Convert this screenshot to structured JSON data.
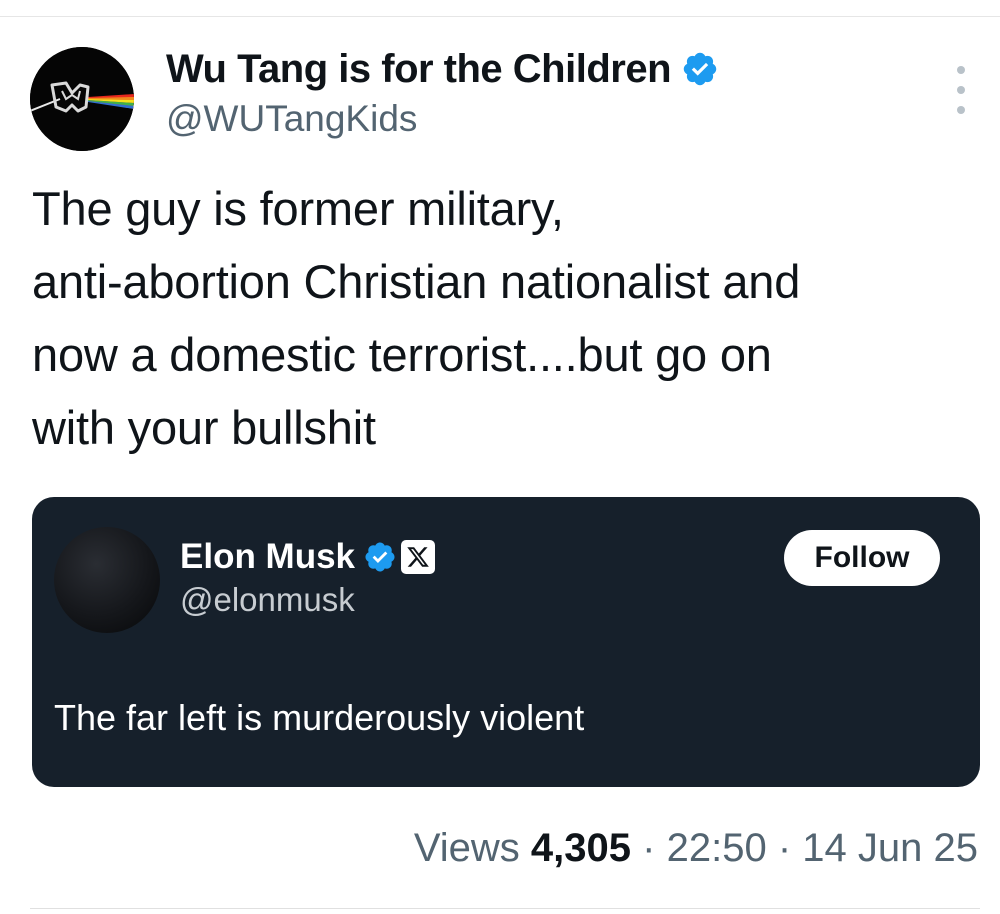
{
  "tweet": {
    "author": {
      "display_name": "Wu Tang is for the Children",
      "handle": "@WUTangKids",
      "verified": true,
      "avatar_icon": "wu-tang-prism-logo-icon"
    },
    "text_lines": [
      "The guy is former military,",
      "anti-abortion Christian nationalist and",
      "now a domestic terrorist....but go on",
      "with your bullshit"
    ],
    "more_icon": "more-vertical-icon",
    "meta": {
      "views_label": "Views",
      "views_count": "4,305",
      "separator": "·",
      "time": "22:50",
      "date": "14 Jun 25"
    }
  },
  "quoted_tweet": {
    "author": {
      "display_name": "Elon Musk",
      "handle": "@elonmusk",
      "verified": true,
      "affiliate_badge": "x-logo-icon"
    },
    "follow_label": "Follow",
    "text": "The far left is murderously violent"
  },
  "colors": {
    "verified_blue": "#1d9bf0",
    "text_primary": "#0f1419",
    "text_secondary": "#536471",
    "quote_background": "#16202b"
  }
}
